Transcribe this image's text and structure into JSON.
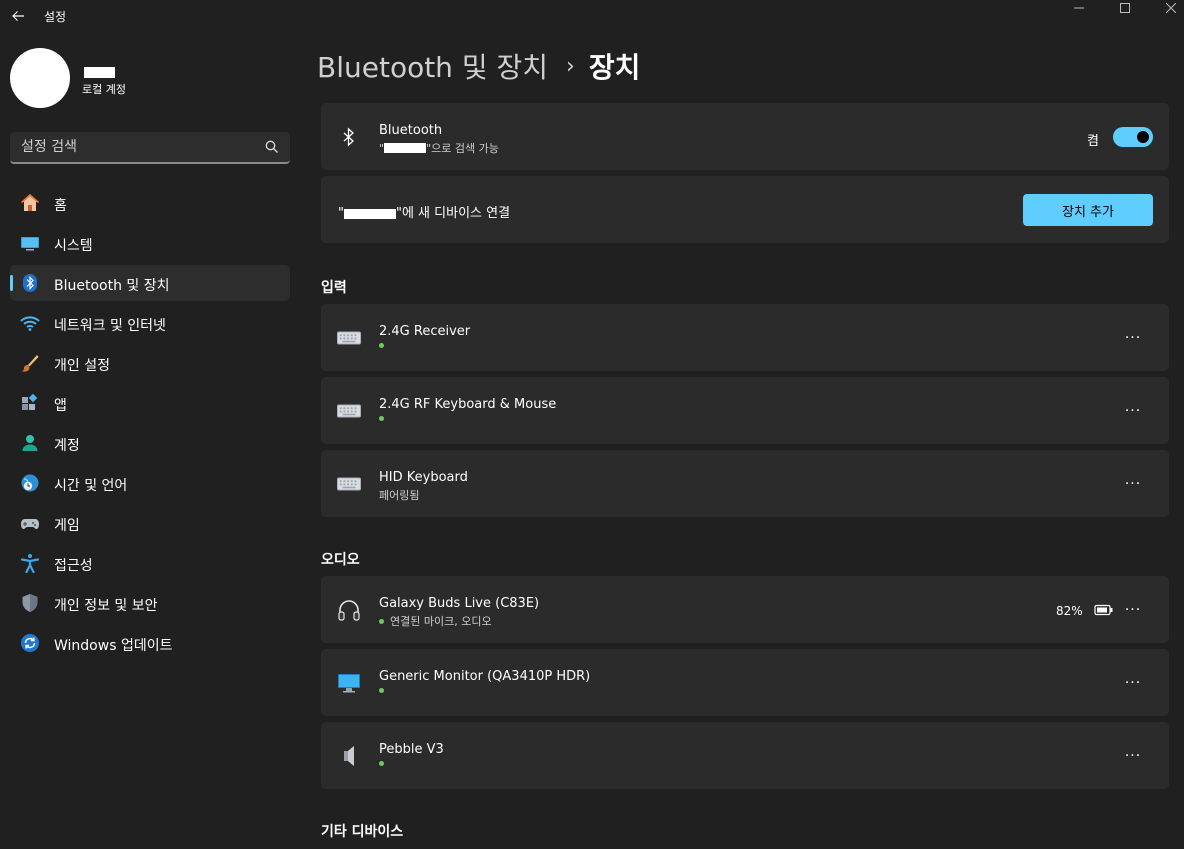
{
  "window": {
    "app_title": "설정",
    "back_label": "←",
    "minimize_label": "—",
    "maximize_label": "☐",
    "close_label": "✕"
  },
  "user": {
    "account_type": "로컬 계정"
  },
  "search": {
    "placeholder": "설정 검색"
  },
  "sidebar": {
    "items": [
      {
        "label": "홈",
        "icon": "home-icon",
        "active": false
      },
      {
        "label": "시스템",
        "icon": "system-icon",
        "active": false
      },
      {
        "label": "Bluetooth 및 장치",
        "icon": "bluetooth-icon",
        "active": true
      },
      {
        "label": "네트워크 및 인터넷",
        "icon": "wifi-icon",
        "active": false
      },
      {
        "label": "개인 설정",
        "icon": "brush-icon",
        "active": false
      },
      {
        "label": "앱",
        "icon": "apps-icon",
        "active": false
      },
      {
        "label": "계정",
        "icon": "person-icon",
        "active": false
      },
      {
        "label": "시간 및 언어",
        "icon": "globe-clock-icon",
        "active": false
      },
      {
        "label": "게임",
        "icon": "gamepad-icon",
        "active": false
      },
      {
        "label": "접근성",
        "icon": "accessibility-icon",
        "active": false
      },
      {
        "label": "개인 정보 및 보안",
        "icon": "shield-icon",
        "active": false
      },
      {
        "label": "Windows 업데이트",
        "icon": "update-icon",
        "active": false
      }
    ]
  },
  "breadcrumb": {
    "parent": "Bluetooth 및 장치",
    "separator": "›",
    "current": "장치"
  },
  "bluetooth_card": {
    "title": "Bluetooth",
    "subtitle_prefix": "\"",
    "subtitle_suffix": "\"으로 검색 가능",
    "toggle_label": "켬",
    "toggle_on": true
  },
  "add_card": {
    "text_prefix": "\"",
    "text_suffix": "\"에 새 디바이스 연결",
    "button_label": "장치 추가"
  },
  "sections": {
    "input": "입력",
    "audio": "오디오",
    "other": "기타 디바이스"
  },
  "devices": {
    "input": [
      {
        "name": "2.4G Receiver",
        "status": "",
        "icon": "keyboard-icon",
        "connected": true
      },
      {
        "name": "2.4G RF Keyboard & Mouse",
        "status": "",
        "icon": "keyboard-icon",
        "connected": true
      },
      {
        "name": "HID Keyboard",
        "status": "페어링됨",
        "icon": "keyboard-icon",
        "connected": false
      }
    ],
    "audio": [
      {
        "name": "Galaxy Buds Live (C83E)",
        "status": "연결된 마이크, 오디오",
        "icon": "headphones-icon",
        "connected": true,
        "battery": "82%"
      },
      {
        "name": "Generic Monitor (QA3410P HDR)",
        "status": "",
        "icon": "monitor-icon",
        "connected": true
      },
      {
        "name": "Pebble V3",
        "status": "",
        "icon": "speaker-icon",
        "connected": true
      }
    ]
  },
  "more_label": "···",
  "colors": {
    "background": "#202020",
    "card": "#2b2b2b",
    "accent": "#60cdff",
    "connected_dot": "#6ccb5f"
  }
}
